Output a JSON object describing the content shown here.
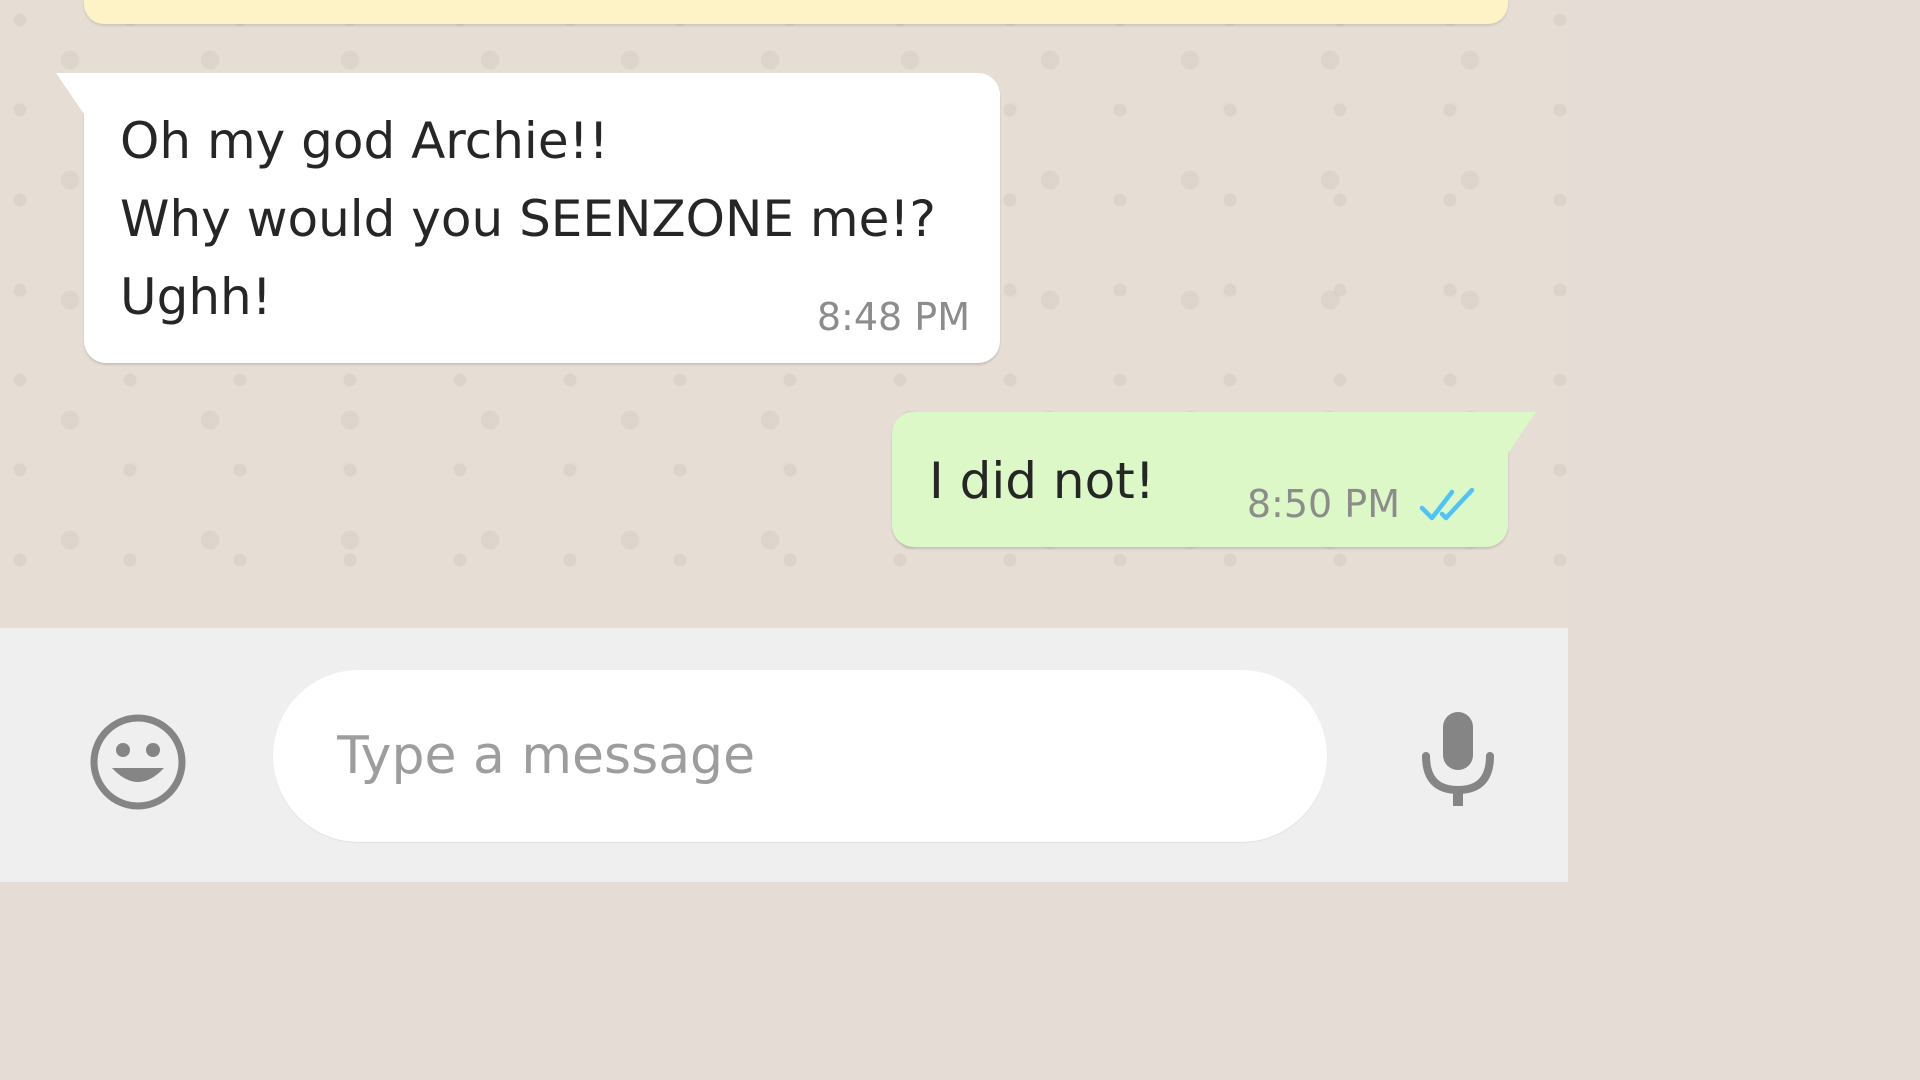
{
  "messages": [
    {
      "direction": "incoming",
      "lines": [
        "Oh my god Archie!!",
        "Why would you SEENZONE me!?",
        "Ughh!"
      ],
      "time": "8:48 PM"
    },
    {
      "direction": "outgoing",
      "lines": [
        "I did not!"
      ],
      "time": "8:50 PM",
      "status_icon": "double-check-read-icon"
    }
  ],
  "composer": {
    "placeholder": "Type a message",
    "value": "",
    "emoji_icon": "smiley-icon",
    "mic_icon": "microphone-icon"
  },
  "colors": {
    "incoming_bubble": "#ffffff",
    "outgoing_bubble": "#dcf8c6",
    "chat_background": "#e6ded5",
    "read_ticks": "#4fc3f7",
    "icon_gray": "#858585"
  }
}
